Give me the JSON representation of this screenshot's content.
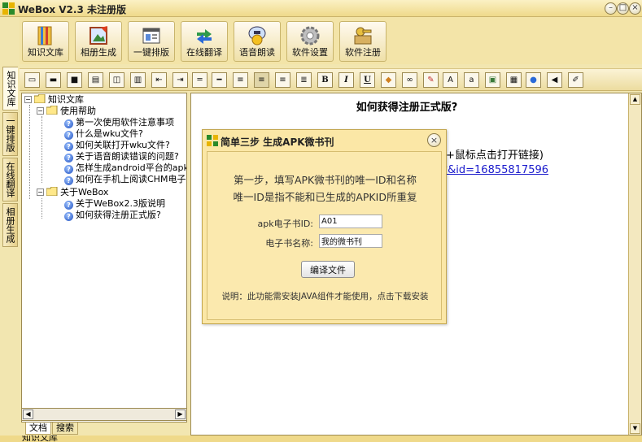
{
  "window": {
    "title": "WeBox V2.3 未注册版",
    "controls": [
      "–",
      "□",
      "×"
    ]
  },
  "toolbar": {
    "buttons": [
      {
        "label": "知识文库",
        "icon": "book-icon"
      },
      {
        "label": "相册生成",
        "icon": "album-icon"
      },
      {
        "label": "一键排版",
        "icon": "layout-icon"
      },
      {
        "label": "在线翻译",
        "icon": "translate-icon"
      },
      {
        "label": "语音朗读",
        "icon": "speech-icon"
      },
      {
        "label": "软件设置",
        "icon": "gear-icon"
      },
      {
        "label": "软件注册",
        "icon": "key-icon"
      }
    ]
  },
  "side_tabs": [
    "知识文库",
    "一键排版",
    "在线翻译",
    "相册生成"
  ],
  "format_toolbar": {
    "bold": "B",
    "italic": "I",
    "underline": "U"
  },
  "tree": {
    "root": "知识文库",
    "groups": [
      {
        "label": "使用帮助",
        "items": [
          "第一次使用软件注意事项",
          "什么是wku文件?",
          "如何关联打开wku文件?",
          "关于语音朗读错误的问题?",
          "怎样生成android平台的apk",
          "如何在手机上阅读CHM电子书"
        ]
      },
      {
        "label": "关于WeBox",
        "items": [
          "关于WeBox2.3版说明",
          "如何获得注册正式版?"
        ]
      }
    ]
  },
  "bottom_tabs": [
    "文档",
    "搜索"
  ],
  "status": "知识文库",
  "content": {
    "title": "如何获得注册正式版?",
    "line1": "建+鼠标点击打开链接)",
    "link": "n?&id=16855817596"
  },
  "dialog": {
    "title": "简单三步 生成APK微书刊",
    "line1": "第一步，填写APK微书刊的唯一ID和名称",
    "line2": "唯一ID是指不能和已生成的APKID所重复",
    "field_id_label": "apk电子书ID:",
    "field_id_value": "A01",
    "field_name_label": "电子书名称:",
    "field_name_value": "我的微书刊",
    "compile_button": "编译文件",
    "note": "说明：此功能需安装JAVA组件才能使用，点击下载安装"
  },
  "colors": {
    "frame": "#f2e6b0",
    "dialog": "#fbe7a6",
    "link": "#1a1acc"
  }
}
